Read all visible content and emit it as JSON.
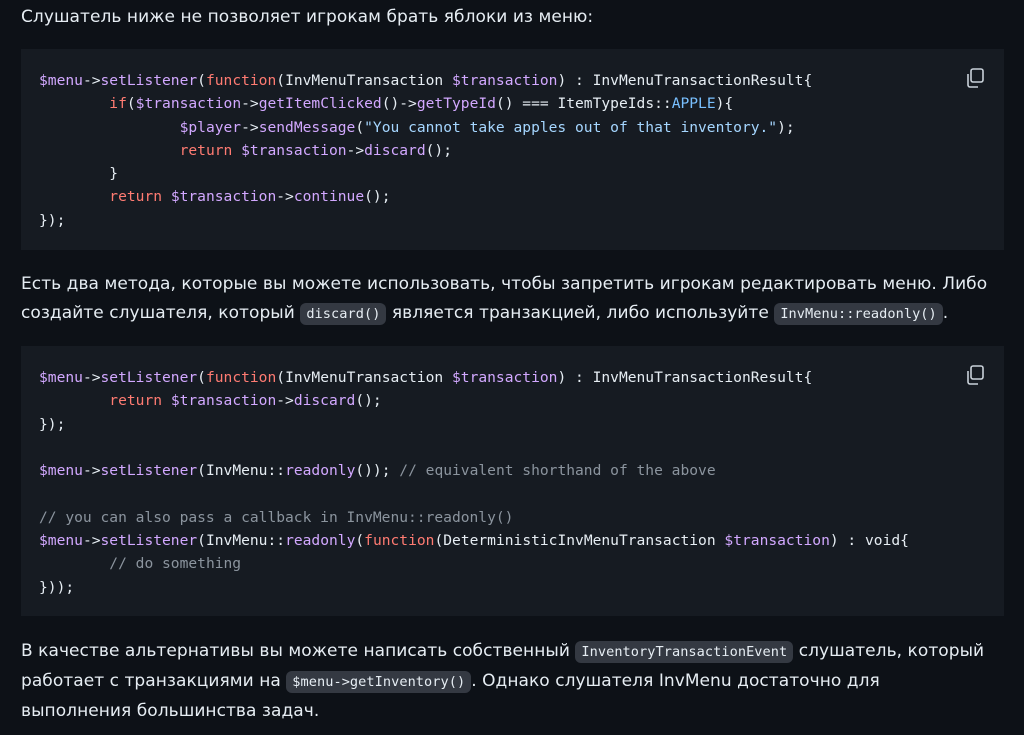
{
  "intro": {
    "text": "Слушатель ниже не позволяет игрокам брать яблоки из меню:"
  },
  "block1": {
    "copy_icon": "copy-icon",
    "lines": [
      [
        [
          "var",
          "$menu"
        ],
        [
          "op",
          "->"
        ],
        [
          "fn",
          "setListener"
        ],
        [
          "op",
          "("
        ],
        [
          "kw",
          "function"
        ],
        [
          "op",
          "("
        ],
        [
          "cls",
          "InvMenuTransaction "
        ],
        [
          "var",
          "$transaction"
        ],
        [
          "op",
          ") : "
        ],
        [
          "cls",
          "InvMenuTransactionResult"
        ],
        [
          "op",
          "{"
        ]
      ],
      [
        [
          "op",
          "        "
        ],
        [
          "kw",
          "if"
        ],
        [
          "op",
          "("
        ],
        [
          "var",
          "$transaction"
        ],
        [
          "op",
          "->"
        ],
        [
          "fn",
          "getItemClicked"
        ],
        [
          "op",
          "()->"
        ],
        [
          "fn",
          "getTypeId"
        ],
        [
          "op",
          "() === "
        ],
        [
          "cls",
          "ItemTypeIds"
        ],
        [
          "op",
          "::"
        ],
        [
          "const",
          "APPLE"
        ],
        [
          "op",
          "){"
        ]
      ],
      [
        [
          "op",
          "                "
        ],
        [
          "var",
          "$player"
        ],
        [
          "op",
          "->"
        ],
        [
          "fn",
          "sendMessage"
        ],
        [
          "op",
          "("
        ],
        [
          "str",
          "\"You cannot take apples out of that inventory.\""
        ],
        [
          "op",
          ");"
        ]
      ],
      [
        [
          "op",
          "                "
        ],
        [
          "kw",
          "return "
        ],
        [
          "var",
          "$transaction"
        ],
        [
          "op",
          "->"
        ],
        [
          "fn",
          "discard"
        ],
        [
          "op",
          "();"
        ]
      ],
      [
        [
          "op",
          "        }"
        ]
      ],
      [
        [
          "op",
          "        "
        ],
        [
          "kw",
          "return "
        ],
        [
          "var",
          "$transaction"
        ],
        [
          "op",
          "->"
        ],
        [
          "fn",
          "continue"
        ],
        [
          "op",
          "();"
        ]
      ],
      [
        [
          "op",
          "});"
        ]
      ]
    ]
  },
  "para2": {
    "before": "Есть два метода, которые вы можете использовать, чтобы запретить игрокам редактировать меню. Либо создайте слушателя, который ",
    "code1": "discard()",
    "middle": " является транзакцией, либо используйте ",
    "code2": "InvMenu::readonly()",
    "after": "."
  },
  "block2": {
    "copy_icon": "copy-icon",
    "lines": [
      [
        [
          "var",
          "$menu"
        ],
        [
          "op",
          "->"
        ],
        [
          "fn",
          "setListener"
        ],
        [
          "op",
          "("
        ],
        [
          "kw",
          "function"
        ],
        [
          "op",
          "("
        ],
        [
          "cls",
          "InvMenuTransaction "
        ],
        [
          "var",
          "$transaction"
        ],
        [
          "op",
          ") : "
        ],
        [
          "cls",
          "InvMenuTransactionResult"
        ],
        [
          "op",
          "{"
        ]
      ],
      [
        [
          "op",
          "        "
        ],
        [
          "kw",
          "return "
        ],
        [
          "var",
          "$transaction"
        ],
        [
          "op",
          "->"
        ],
        [
          "fn",
          "discard"
        ],
        [
          "op",
          "();"
        ]
      ],
      [
        [
          "op",
          "});"
        ]
      ],
      [
        [
          "op",
          " "
        ]
      ],
      [
        [
          "var",
          "$menu"
        ],
        [
          "op",
          "->"
        ],
        [
          "fn",
          "setListener"
        ],
        [
          "op",
          "("
        ],
        [
          "cls",
          "InvMenu"
        ],
        [
          "op",
          "::"
        ],
        [
          "fn",
          "readonly"
        ],
        [
          "op",
          "()); "
        ],
        [
          "cm",
          "// equivalent shorthand of the above"
        ]
      ],
      [
        [
          "op",
          " "
        ]
      ],
      [
        [
          "cm",
          "// you can also pass a callback in InvMenu::readonly()"
        ]
      ],
      [
        [
          "var",
          "$menu"
        ],
        [
          "op",
          "->"
        ],
        [
          "fn",
          "setListener"
        ],
        [
          "op",
          "("
        ],
        [
          "cls",
          "InvMenu"
        ],
        [
          "op",
          "::"
        ],
        [
          "fn",
          "readonly"
        ],
        [
          "op",
          "("
        ],
        [
          "kw",
          "function"
        ],
        [
          "op",
          "("
        ],
        [
          "cls",
          "DeterministicInvMenuTransaction "
        ],
        [
          "var",
          "$transaction"
        ],
        [
          "op",
          ") : void{"
        ]
      ],
      [
        [
          "op",
          "        "
        ],
        [
          "cm",
          "// do something"
        ]
      ],
      [
        [
          "op",
          "}));"
        ]
      ]
    ]
  },
  "para3": {
    "before": "В качестве альтернативы вы можете написать собственный ",
    "code1": "InventoryTransactionEvent",
    "middle": " слушатель, который работает с транзакциями на ",
    "code2": "$menu->getInventory()",
    "after": ". Однако слушателя InvMenu достаточно для выполнения большинства задач."
  }
}
